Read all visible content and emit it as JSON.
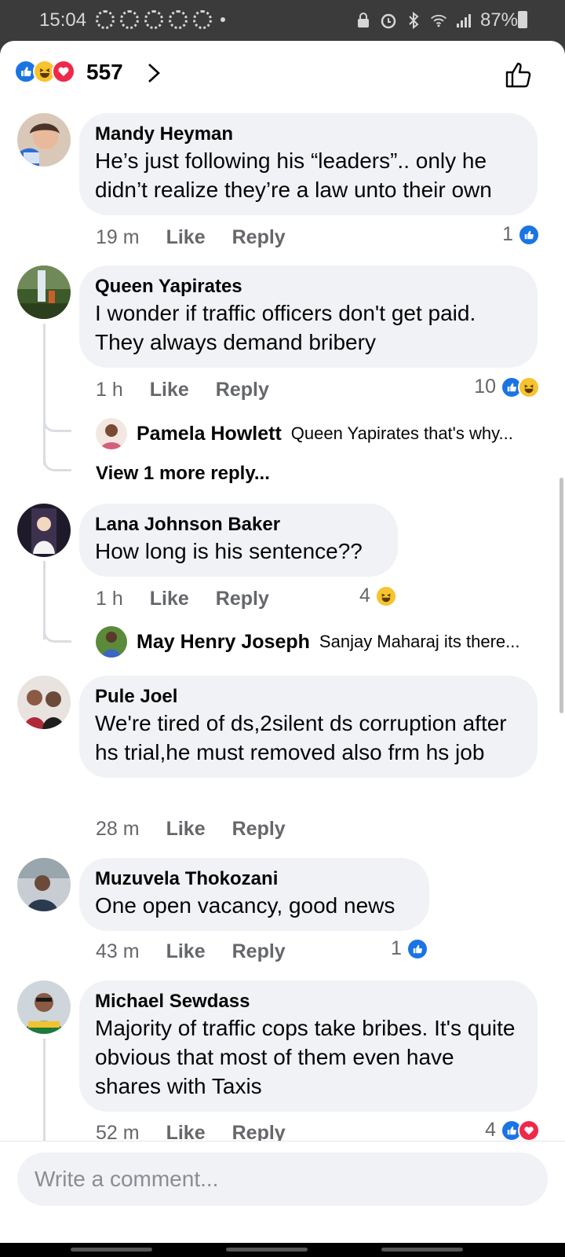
{
  "status_bar": {
    "time": "15:04",
    "battery": "87%"
  },
  "header": {
    "reaction_count": "557"
  },
  "comments": [
    {
      "author": "Mandy Heyman",
      "text": "He’s just following his “leaders”.. only he didn’t realize they’re a law unto their own",
      "time": "19 m",
      "like_label": "Like",
      "reply_label": "Reply",
      "reactions_count": "1",
      "reactions": [
        "like"
      ]
    },
    {
      "author": "Queen Yapirates",
      "text": "I wonder if traffic officers don't get paid. They always demand bribery",
      "time": "1 h",
      "like_label": "Like",
      "reply_label": "Reply",
      "reactions_count": "10",
      "reactions": [
        "like",
        "haha"
      ],
      "reply_preview": {
        "author": "Pamela Howlett",
        "snippet": "Queen Yapirates that's why..."
      },
      "view_more": "View 1 more reply..."
    },
    {
      "author": "Lana Johnson Baker",
      "text": "How long is his sentence??",
      "time": "1 h",
      "like_label": "Like",
      "reply_label": "Reply",
      "reactions_count": "4",
      "reactions": [
        "haha"
      ],
      "reply_preview": {
        "author": "May Henry Joseph",
        "snippet": "Sanjay Maharaj its there..."
      }
    },
    {
      "author": "Pule Joel",
      "text": "We're tired of ds,2silent ds corruption after hs trial,he must removed also frm hs job",
      "time": "28 m",
      "like_label": "Like",
      "reply_label": "Reply"
    },
    {
      "author": "Muzuvela Thokozani",
      "text": "One open vacancy, good news",
      "time": "43 m",
      "like_label": "Like",
      "reply_label": "Reply",
      "reactions_count": "1",
      "reactions": [
        "like"
      ]
    },
    {
      "author": "Michael Sewdass",
      "text": "Majority of traffic cops take bribes. It's quite obvious that most of them even have shares with Taxis",
      "time": "52 m",
      "like_label": "Like",
      "reply_label": "Reply",
      "reactions_count": "4",
      "reactions": [
        "like",
        "love"
      ]
    }
  ],
  "composer": {
    "placeholder": "Write a comment..."
  },
  "colors": {
    "like_blue": "#1b74e4",
    "haha_yellow": "#f7c32e",
    "love_red": "#f0284a",
    "bubble_gray": "#f0f2f5",
    "meta_gray": "#65676b"
  }
}
